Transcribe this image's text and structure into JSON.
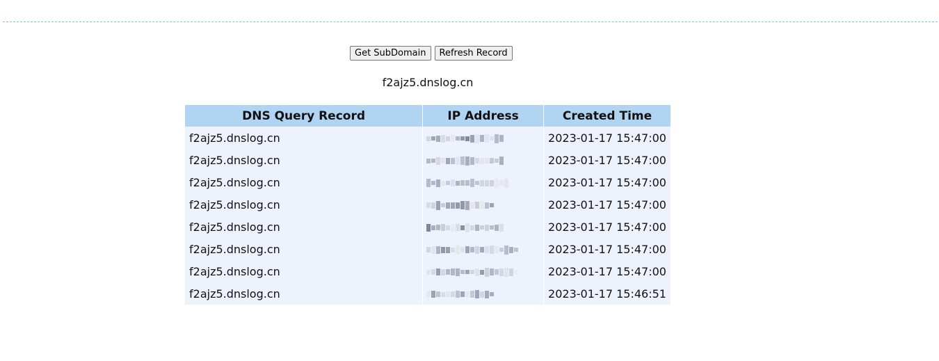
{
  "toolbar": {
    "get_subdomain_label": "Get SubDomain",
    "refresh_record_label": "Refresh Record"
  },
  "subdomain": "f2ajz5.dnslog.cn",
  "table": {
    "headers": [
      "DNS Query Record",
      "IP Address",
      "Created Time"
    ],
    "rows": [
      {
        "domain": "f2ajz5.dnslog.cn",
        "time": "2023-01-17 15:47:00"
      },
      {
        "domain": "f2ajz5.dnslog.cn",
        "time": "2023-01-17 15:47:00"
      },
      {
        "domain": "f2ajz5.dnslog.cn",
        "time": "2023-01-17 15:47:00"
      },
      {
        "domain": "f2ajz5.dnslog.cn",
        "time": "2023-01-17 15:47:00"
      },
      {
        "domain": "f2ajz5.dnslog.cn",
        "time": "2023-01-17 15:47:00"
      },
      {
        "domain": "f2ajz5.dnslog.cn",
        "time": "2023-01-17 15:47:00"
      },
      {
        "domain": "f2ajz5.dnslog.cn",
        "time": "2023-01-17 15:47:00"
      },
      {
        "domain": "f2ajz5.dnslog.cn",
        "time": "2023-01-17 15:46:51"
      }
    ]
  },
  "colors": {
    "header_bg": "#b0d4f1",
    "row_bg": "#eef2fd",
    "divider": "#7fbfe0"
  }
}
